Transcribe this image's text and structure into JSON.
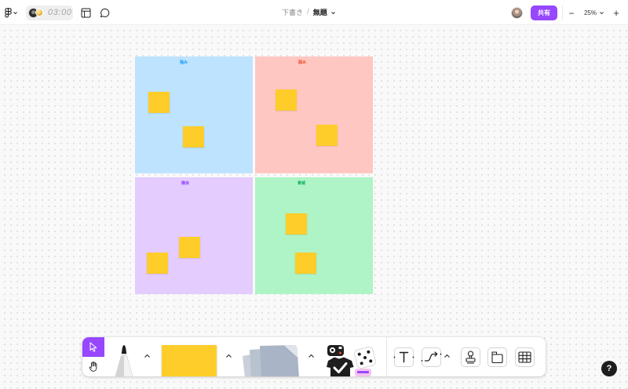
{
  "topbar": {
    "menu_icon": "figjam-logo-icon",
    "timer": "03:00",
    "layout_icon": "layout-icon",
    "comment_icon": "chat-icon",
    "breadcrumb": {
      "folder": "下書き",
      "separator": "/",
      "file": "無題"
    },
    "share_label": "共有",
    "share_color": "#9747FF",
    "zoom": {
      "out_symbol": "−",
      "level": "25%",
      "in_symbol": "+"
    }
  },
  "board": {
    "sticky_color": "#FFCD29",
    "quadrants": [
      {
        "label": "強み",
        "fill": "#BDE3FF",
        "label_color": "#0D99FF"
      },
      {
        "label": "弱み",
        "fill": "#FFC7C2",
        "label_color": "#F24822"
      },
      {
        "label": "機会",
        "fill": "#E4CCFF",
        "label_color": "#9747FF"
      },
      {
        "label": "脅威",
        "fill": "#AFF4C6",
        "label_color": "#14AE5C"
      }
    ]
  },
  "toolbar": {
    "active_tool": "cursor-icon",
    "accent_color": "#9747FF",
    "tools": [
      "cursor-icon",
      "hand-icon",
      "marker-icon",
      "sticky-note-icon",
      "shapes-icon",
      "stickers-icon",
      "text-icon",
      "connector-icon",
      "stamp-icon",
      "section-icon",
      "table-icon"
    ]
  },
  "help": {
    "label": "?"
  }
}
